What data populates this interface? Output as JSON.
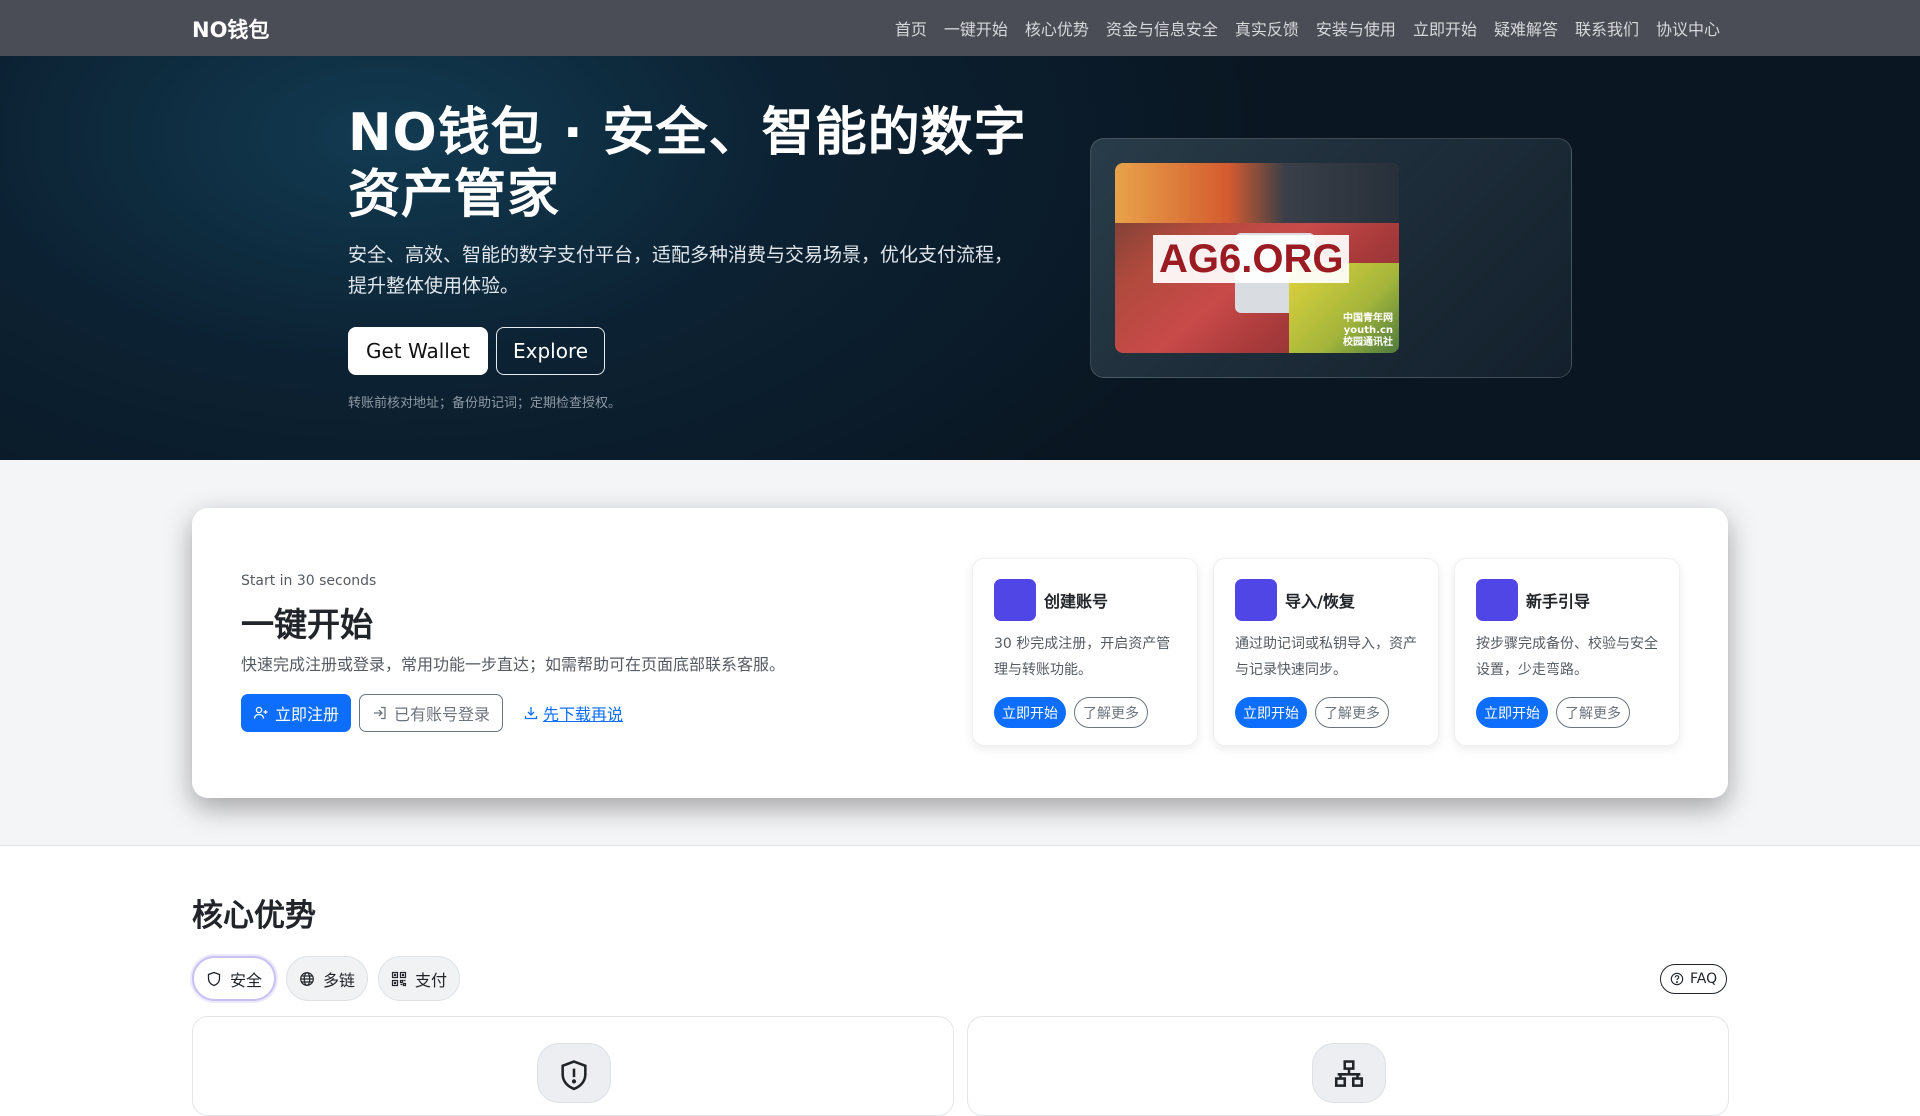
{
  "nav": {
    "brand": "NO钱包",
    "links": [
      "首页",
      "一键开始",
      "核心优势",
      "资金与信息安全",
      "真实反馈",
      "安装与使用",
      "立即开始",
      "疑难解答",
      "联系我们",
      "协议中心"
    ]
  },
  "hero": {
    "title": "NO钱包 · 安全、智能的数字资产管家",
    "subtitle": "安全、高效、智能的数字支付平台，适配多种消费与交易场景，优化支付流程，提升整体使用体验。",
    "primary_btn": "Get Wallet",
    "secondary_btn": "Explore",
    "note": "转账前核对地址；备份助记词；定期检查授权。",
    "image_label": "AG6.ORG",
    "image_watermark_1": "中国青年网",
    "image_watermark_2": "youth.cn",
    "image_watermark_3": "校园通讯社"
  },
  "quickstart": {
    "kicker": "Start in 30 seconds",
    "title": "一键开始",
    "desc": "快速完成注册或登录，常用功能一步直达；如需帮助可在页面底部联系客服。",
    "register_btn": "立即注册",
    "login_btn": "已有账号登录",
    "download_link": "先下载再说",
    "cards": [
      {
        "title": "创建账号",
        "text": "30 秒完成注册，开启资产管理与转账功能。",
        "primary": "立即开始",
        "secondary": "了解更多"
      },
      {
        "title": "导入/恢复",
        "text": "通过助记词或私钥导入，资产与记录快速同步。",
        "primary": "立即开始",
        "secondary": "了解更多"
      },
      {
        "title": "新手引导",
        "text": "按步骤完成备份、校验与安全设置，少走弯路。",
        "primary": "立即开始",
        "secondary": "了解更多"
      }
    ]
  },
  "core": {
    "title": "核心优势",
    "tabs": [
      "安全",
      "多链",
      "支付"
    ],
    "faq": "FAQ"
  },
  "colors": {
    "accent": "#0d6efd",
    "card_icon": "#4f46e5",
    "navbar": "#4a4d55"
  }
}
